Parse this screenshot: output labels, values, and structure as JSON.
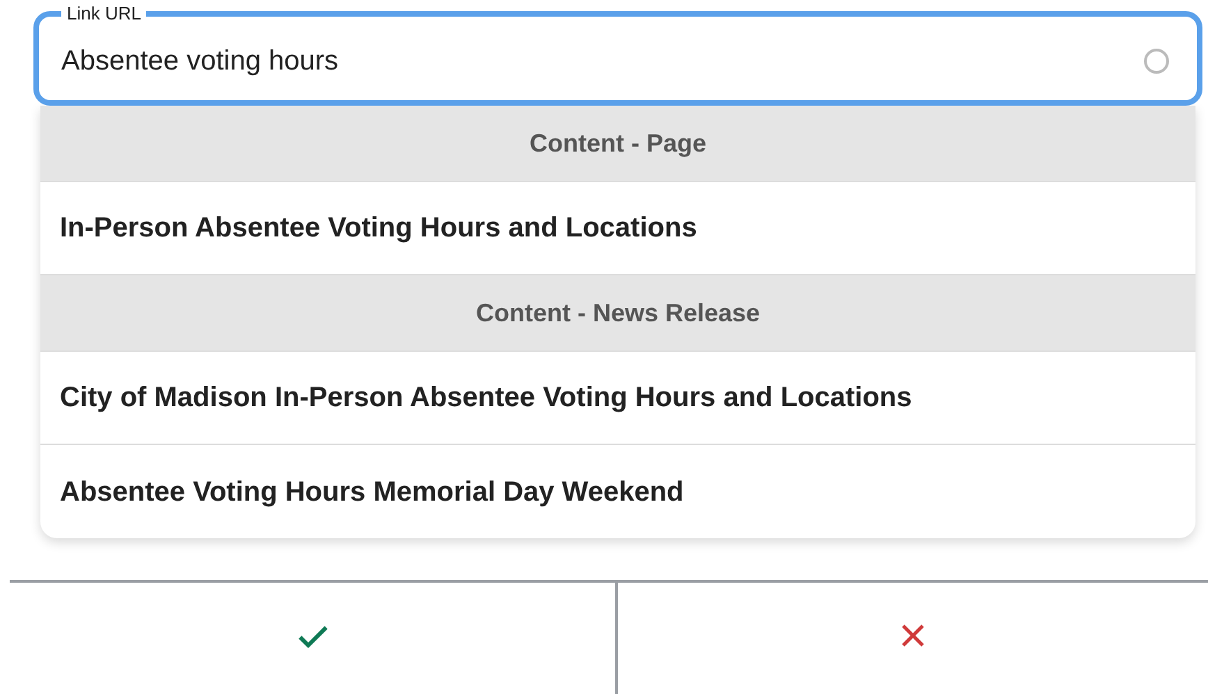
{
  "field": {
    "label": "Link URL",
    "value": "Absentee voting hours"
  },
  "results": [
    {
      "kind": "header",
      "text": "Content - Page"
    },
    {
      "kind": "item",
      "text": "In-Person Absentee Voting Hours and Locations"
    },
    {
      "kind": "header",
      "text": "Content - News Release"
    },
    {
      "kind": "item",
      "text": "City of Madison In-Person Absentee Voting Hours and Locations"
    },
    {
      "kind": "item",
      "text": "Absentee Voting Hours Memorial Day Weekend"
    }
  ]
}
